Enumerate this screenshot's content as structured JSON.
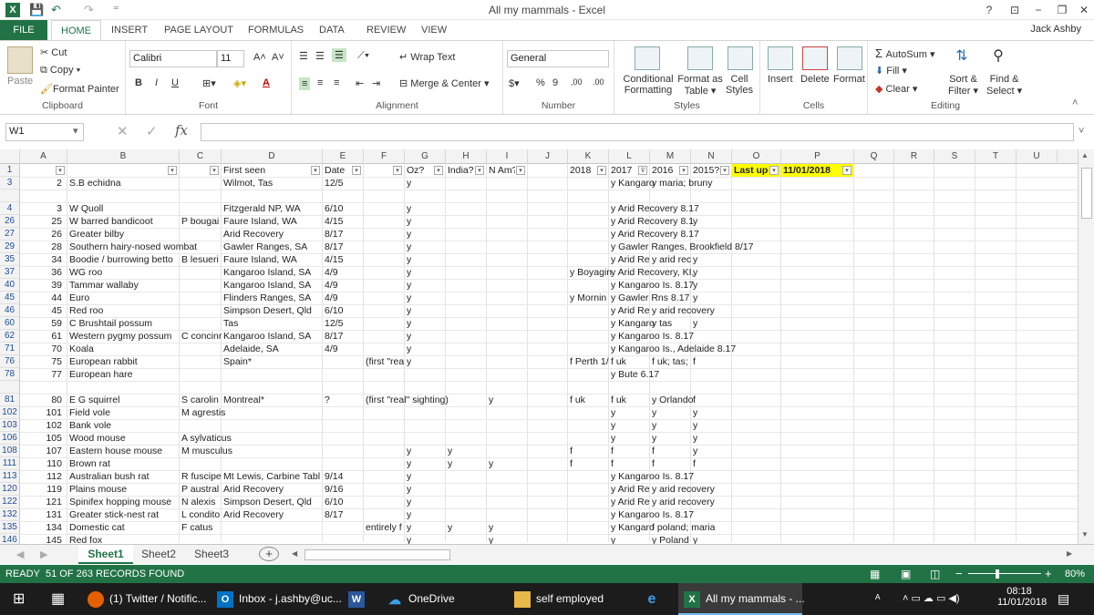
{
  "window": {
    "title": "All my mammals - Excel",
    "help": "?",
    "minimize": "−",
    "maximize": "❐",
    "close": "✕",
    "logo_text": "X"
  },
  "quick_access": {
    "save": "💾",
    "undo": "↶",
    "redo": "↷",
    "customize": "⁼"
  },
  "tabs": [
    "FILE",
    "HOME",
    "INSERT",
    "PAGE LAYOUT",
    "FORMULAS",
    "DATA",
    "REVIEW",
    "VIEW"
  ],
  "user": "Jack Ashby",
  "ribbon": {
    "clipboard": {
      "paste": "Paste",
      "cut": "Cut",
      "copy": "Copy",
      "format_painter": "Format Painter",
      "label": "Clipboard"
    },
    "font": {
      "name": "Calibri",
      "size": "11",
      "bold": "B",
      "italic": "I",
      "underline": "U",
      "grow": "A˄",
      "shrink": "A˅",
      "label": "Font"
    },
    "alignment": {
      "wrap": "Wrap Text",
      "merge": "Merge & Center",
      "label": "Alignment"
    },
    "number": {
      "format": "General",
      "currency": "$",
      "percent": "%",
      "comma": "9",
      "inc": ",00",
      "dec": ".00",
      "label": "Number"
    },
    "styles": {
      "conditional": "Conditional",
      "conditional2": "Formatting",
      "format_as": "Format as",
      "format_as2": "Table",
      "cell": "Cell",
      "cell2": "Styles",
      "label": "Styles"
    },
    "cells": {
      "insert": "Insert",
      "delete": "Delete",
      "format": "Format",
      "label": "Cells"
    },
    "editing": {
      "autosum": "AutoSum",
      "fill": "Fill",
      "clear": "Clear",
      "sort": "Sort &",
      "sort2": "Filter",
      "find": "Find &",
      "find2": "Select",
      "label": "Editing"
    }
  },
  "formula_bar": {
    "name_box": "W1",
    "fx": "fx",
    "value": ""
  },
  "columns": [
    "A",
    "B",
    "C",
    "D",
    "E",
    "F",
    "G",
    "H",
    "I",
    "J",
    "K",
    "L",
    "M",
    "N",
    "O",
    "P",
    "Q",
    "R",
    "S",
    "T",
    "U"
  ],
  "header_row": {
    "row_num": "1",
    "D": "First seen",
    "E": "Date",
    "G": "Oz?",
    "H": "India?",
    "I": "N Am?",
    "K": "2018",
    "L": "2017",
    "M": "2016",
    "N": "2015?",
    "O": "Last upda",
    "P": "11/01/2018"
  },
  "rows": [
    {
      "n": "3",
      "A": "2",
      "B": "S.B echidna",
      "C": "",
      "D": "Wilmot, Tas",
      "E": "12/5",
      "F": "",
      "G": "y",
      "H": "",
      "I": "",
      "K": "",
      "L": "y Kangaro",
      "M": "y maria; bruny",
      "N": ""
    },
    {
      "n": "4",
      "A": "3",
      "B": "W Quoll",
      "C": "",
      "D": "Fitzgerald NP, WA",
      "E": "6/10",
      "F": "",
      "G": "y",
      "H": "",
      "I": "",
      "K": "",
      "L": "y Arid Recovery 8.17",
      "M": "",
      "N": ""
    },
    {
      "n": "26",
      "A": "25",
      "B": "W barred bandicoot",
      "C": "P bougai",
      "D": "Faure Island, WA",
      "E": "4/15",
      "F": "",
      "G": "y",
      "H": "",
      "I": "",
      "K": "",
      "L": "y Arid Recovery 8.1",
      "M": "",
      "N": "y"
    },
    {
      "n": "27",
      "A": "26",
      "B": "Greater bilby",
      "C": "",
      "D": "Arid Recovery",
      "E": "8/17",
      "F": "",
      "G": "y",
      "H": "",
      "I": "",
      "K": "",
      "L": "y Arid Recovery 8.17",
      "M": "",
      "N": ""
    },
    {
      "n": "29",
      "A": "28",
      "B": "Southern hairy-nosed wombat",
      "C": "",
      "D": "Gawler Ranges, SA",
      "E": "8/17",
      "F": "",
      "G": "y",
      "H": "",
      "I": "",
      "K": "",
      "L": "y Gawler Ranges, Brookfield 8/17",
      "M": "",
      "N": ""
    },
    {
      "n": "35",
      "A": "34",
      "B": "Boodie / burrowing betto",
      "C": "B lesueri",
      "D": "Faure Island, WA",
      "E": "4/15",
      "F": "",
      "G": "y",
      "H": "",
      "I": "",
      "K": "",
      "L": "y Arid Re",
      "M": "y arid rec",
      "N": "y"
    },
    {
      "n": "37",
      "A": "36",
      "B": "WG roo",
      "C": "",
      "D": "Kangaroo Island, SA",
      "E": "4/9",
      "F": "",
      "G": "y",
      "H": "",
      "I": "",
      "K": "y Boyagin",
      "L": "y Arid Recovery, KI,",
      "M": "",
      "N": "y"
    },
    {
      "n": "40",
      "A": "39",
      "B": "Tammar wallaby",
      "C": "",
      "D": "Kangaroo Island, SA",
      "E": "4/9",
      "F": "",
      "G": "y",
      "H": "",
      "I": "",
      "K": "",
      "L": "y Kangaroo Is. 8.17",
      "M": "",
      "N": "y"
    },
    {
      "n": "45",
      "A": "44",
      "B": "Euro",
      "C": "",
      "D": "Flinders Ranges, SA",
      "E": "4/9",
      "F": "",
      "G": "y",
      "H": "",
      "I": "",
      "K": "y Mornin",
      "L": "y Gawler Rns 8.17",
      "M": "",
      "N": "y"
    },
    {
      "n": "46",
      "A": "45",
      "B": "Red roo",
      "C": "",
      "D": "Simpson Desert, Qld",
      "E": "6/10",
      "F": "",
      "G": "y",
      "H": "",
      "I": "",
      "K": "",
      "L": "y Arid Re",
      "M": "y arid recovery",
      "N": ""
    },
    {
      "n": "60",
      "A": "59",
      "B": "C Brushtail possum",
      "C": "",
      "D": "Tas",
      "E": "12/5",
      "F": "",
      "G": "y",
      "H": "",
      "I": "",
      "K": "",
      "L": "y Kangaro",
      "M": "y tas",
      "N": "y"
    },
    {
      "n": "62",
      "A": "61",
      "B": "Western pygmy possum",
      "C": "C concinr",
      "D": "Kangaroo Island, SA",
      "E": "8/17",
      "F": "",
      "G": "y",
      "H": "",
      "I": "",
      "K": "",
      "L": "y Kangaroo Is. 8.17",
      "M": "",
      "N": ""
    },
    {
      "n": "71",
      "A": "70",
      "B": "Koala",
      "C": "",
      "D": "Adelaide, SA",
      "E": "4/9",
      "F": "",
      "G": "y",
      "H": "",
      "I": "",
      "K": "",
      "L": "y Kangaroo Is., Adelaide 8.17",
      "M": "",
      "N": ""
    },
    {
      "n": "76",
      "A": "75",
      "B": "European rabbit",
      "C": "",
      "D": "Spain*",
      "E": "",
      "F": "(first \"rea",
      "G": "y",
      "H": "",
      "I": "",
      "K": "f Perth 1/",
      "L": "f uk",
      "M": "f uk; tas;",
      "N": "f"
    },
    {
      "n": "78",
      "A": "77",
      "B": "European hare",
      "C": "",
      "D": "",
      "E": "",
      "F": "",
      "G": "",
      "H": "",
      "I": "",
      "K": "",
      "L": "y Bute 6.17",
      "M": "",
      "N": ""
    },
    {
      "n": "81",
      "A": "80",
      "B": "E G squirrel",
      "C": "S carolin",
      "D": "Montreal*",
      "E": "?",
      "F": "(first \"real\" sighting)",
      "G": "",
      "H": "",
      "I": "y",
      "K": "f uk",
      "L": "f uk",
      "M": "y Orlando",
      "N": "f"
    },
    {
      "n": "102",
      "A": "101",
      "B": "Field vole",
      "C": "M agrestis",
      "D": "",
      "E": "",
      "F": "",
      "G": "",
      "H": "",
      "I": "",
      "K": "",
      "L": "y",
      "M": "y",
      "N": "y"
    },
    {
      "n": "103",
      "A": "102",
      "B": "Bank vole",
      "C": "",
      "D": "",
      "E": "",
      "F": "",
      "G": "",
      "H": "",
      "I": "",
      "K": "",
      "L": "y",
      "M": "y",
      "N": "y"
    },
    {
      "n": "106",
      "A": "105",
      "B": "Wood mouse",
      "C": "A sylvaticus",
      "D": "",
      "E": "",
      "F": "",
      "G": "",
      "H": "",
      "I": "",
      "K": "",
      "L": "y",
      "M": "y",
      "N": "y"
    },
    {
      "n": "108",
      "A": "107",
      "B": "Eastern house mouse",
      "C": "M musculus",
      "D": "",
      "E": "",
      "F": "",
      "G": "y",
      "H": "y",
      "I": "",
      "K": "f",
      "L": "f",
      "M": "f",
      "N": "y"
    },
    {
      "n": "111",
      "A": "110",
      "B": "Brown rat",
      "C": "",
      "D": "",
      "E": "",
      "F": "",
      "G": "y",
      "H": "y",
      "I": "y",
      "K": "f",
      "L": "f",
      "M": "f",
      "N": "f"
    },
    {
      "n": "113",
      "A": "112",
      "B": "Australian bush rat",
      "C": "R fuscipe",
      "D": "Mt Lewis, Carbine Tabl",
      "E": "9/14",
      "F": "",
      "G": "y",
      "H": "",
      "I": "",
      "K": "",
      "L": "y Kangaroo Is. 8.17",
      "M": "",
      "N": ""
    },
    {
      "n": "120",
      "A": "119",
      "B": "Plains mouse",
      "C": "P austral",
      "D": "Arid Recovery",
      "E": "9/16",
      "F": "",
      "G": "y",
      "H": "",
      "I": "",
      "K": "",
      "L": "y Arid Re",
      "M": "y arid recovery",
      "N": ""
    },
    {
      "n": "122",
      "A": "121",
      "B": "Spinifex hopping mouse",
      "C": "N alexis",
      "D": "Simpson Desert, Qld",
      "E": "6/10",
      "F": "",
      "G": "y",
      "H": "",
      "I": "",
      "K": "",
      "L": "y Arid Re",
      "M": "y arid recovery",
      "N": ""
    },
    {
      "n": "132",
      "A": "131",
      "B": "Greater stick-nest rat",
      "C": "L condito",
      "D": "Arid Recovery",
      "E": "8/17",
      "F": "",
      "G": "y",
      "H": "",
      "I": "",
      "K": "",
      "L": "y Kangaroo Is. 8.17",
      "M": "",
      "N": ""
    },
    {
      "n": "135",
      "A": "134",
      "B": "Domestic cat",
      "C": "F catus",
      "D": "",
      "E": "",
      "F": "entirely f",
      "G": "y",
      "H": "y",
      "I": "y",
      "K": "",
      "L": "y Kangaro",
      "M": "f poland; maria",
      "N": ""
    },
    {
      "n": "146",
      "A": "145",
      "B": "Red fox",
      "C": "",
      "D": "",
      "E": "",
      "F": "",
      "G": "y",
      "H": "",
      "I": "y",
      "K": "",
      "L": "y",
      "M": "y Poland",
      "N": "y"
    }
  ],
  "sheets": [
    "Sheet1",
    "Sheet2",
    "Sheet3"
  ],
  "add_sheet": "+",
  "status": {
    "ready": "READY",
    "records": "51 OF 263 RECORDS FOUND",
    "zoom": "80%",
    "zoom_minus": "−",
    "zoom_plus": "+"
  },
  "taskbar": {
    "items": [
      "(1) Twitter / Notific...",
      "Inbox - j.ashby@uc...",
      "OneDrive",
      "self employed",
      "All my mammals - ..."
    ],
    "time": "08:18",
    "date": "11/01/2018"
  },
  "colors": {
    "excel_green": "#217346",
    "highlight_yellow": "#ffff00",
    "taskbar": "#1c1c1c"
  }
}
